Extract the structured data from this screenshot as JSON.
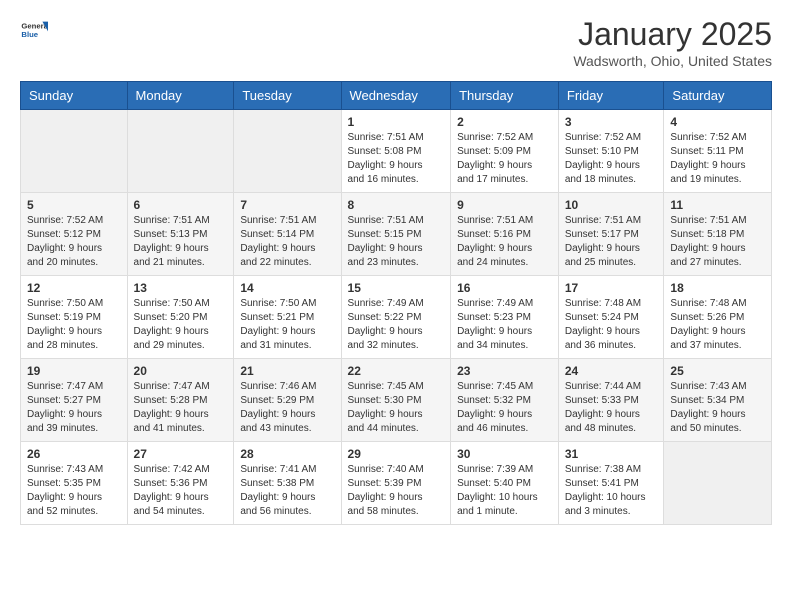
{
  "logo": {
    "general": "General",
    "blue": "Blue"
  },
  "header": {
    "title": "January 2025",
    "subtitle": "Wadsworth, Ohio, United States"
  },
  "weekdays": [
    "Sunday",
    "Monday",
    "Tuesday",
    "Wednesday",
    "Thursday",
    "Friday",
    "Saturday"
  ],
  "weeks": [
    [
      {
        "day": "",
        "info": ""
      },
      {
        "day": "",
        "info": ""
      },
      {
        "day": "",
        "info": ""
      },
      {
        "day": "1",
        "info": "Sunrise: 7:51 AM\nSunset: 5:08 PM\nDaylight: 9 hours\nand 16 minutes."
      },
      {
        "day": "2",
        "info": "Sunrise: 7:52 AM\nSunset: 5:09 PM\nDaylight: 9 hours\nand 17 minutes."
      },
      {
        "day": "3",
        "info": "Sunrise: 7:52 AM\nSunset: 5:10 PM\nDaylight: 9 hours\nand 18 minutes."
      },
      {
        "day": "4",
        "info": "Sunrise: 7:52 AM\nSunset: 5:11 PM\nDaylight: 9 hours\nand 19 minutes."
      }
    ],
    [
      {
        "day": "5",
        "info": "Sunrise: 7:52 AM\nSunset: 5:12 PM\nDaylight: 9 hours\nand 20 minutes."
      },
      {
        "day": "6",
        "info": "Sunrise: 7:51 AM\nSunset: 5:13 PM\nDaylight: 9 hours\nand 21 minutes."
      },
      {
        "day": "7",
        "info": "Sunrise: 7:51 AM\nSunset: 5:14 PM\nDaylight: 9 hours\nand 22 minutes."
      },
      {
        "day": "8",
        "info": "Sunrise: 7:51 AM\nSunset: 5:15 PM\nDaylight: 9 hours\nand 23 minutes."
      },
      {
        "day": "9",
        "info": "Sunrise: 7:51 AM\nSunset: 5:16 PM\nDaylight: 9 hours\nand 24 minutes."
      },
      {
        "day": "10",
        "info": "Sunrise: 7:51 AM\nSunset: 5:17 PM\nDaylight: 9 hours\nand 25 minutes."
      },
      {
        "day": "11",
        "info": "Sunrise: 7:51 AM\nSunset: 5:18 PM\nDaylight: 9 hours\nand 27 minutes."
      }
    ],
    [
      {
        "day": "12",
        "info": "Sunrise: 7:50 AM\nSunset: 5:19 PM\nDaylight: 9 hours\nand 28 minutes."
      },
      {
        "day": "13",
        "info": "Sunrise: 7:50 AM\nSunset: 5:20 PM\nDaylight: 9 hours\nand 29 minutes."
      },
      {
        "day": "14",
        "info": "Sunrise: 7:50 AM\nSunset: 5:21 PM\nDaylight: 9 hours\nand 31 minutes."
      },
      {
        "day": "15",
        "info": "Sunrise: 7:49 AM\nSunset: 5:22 PM\nDaylight: 9 hours\nand 32 minutes."
      },
      {
        "day": "16",
        "info": "Sunrise: 7:49 AM\nSunset: 5:23 PM\nDaylight: 9 hours\nand 34 minutes."
      },
      {
        "day": "17",
        "info": "Sunrise: 7:48 AM\nSunset: 5:24 PM\nDaylight: 9 hours\nand 36 minutes."
      },
      {
        "day": "18",
        "info": "Sunrise: 7:48 AM\nSunset: 5:26 PM\nDaylight: 9 hours\nand 37 minutes."
      }
    ],
    [
      {
        "day": "19",
        "info": "Sunrise: 7:47 AM\nSunset: 5:27 PM\nDaylight: 9 hours\nand 39 minutes."
      },
      {
        "day": "20",
        "info": "Sunrise: 7:47 AM\nSunset: 5:28 PM\nDaylight: 9 hours\nand 41 minutes."
      },
      {
        "day": "21",
        "info": "Sunrise: 7:46 AM\nSunset: 5:29 PM\nDaylight: 9 hours\nand 43 minutes."
      },
      {
        "day": "22",
        "info": "Sunrise: 7:45 AM\nSunset: 5:30 PM\nDaylight: 9 hours\nand 44 minutes."
      },
      {
        "day": "23",
        "info": "Sunrise: 7:45 AM\nSunset: 5:32 PM\nDaylight: 9 hours\nand 46 minutes."
      },
      {
        "day": "24",
        "info": "Sunrise: 7:44 AM\nSunset: 5:33 PM\nDaylight: 9 hours\nand 48 minutes."
      },
      {
        "day": "25",
        "info": "Sunrise: 7:43 AM\nSunset: 5:34 PM\nDaylight: 9 hours\nand 50 minutes."
      }
    ],
    [
      {
        "day": "26",
        "info": "Sunrise: 7:43 AM\nSunset: 5:35 PM\nDaylight: 9 hours\nand 52 minutes."
      },
      {
        "day": "27",
        "info": "Sunrise: 7:42 AM\nSunset: 5:36 PM\nDaylight: 9 hours\nand 54 minutes."
      },
      {
        "day": "28",
        "info": "Sunrise: 7:41 AM\nSunset: 5:38 PM\nDaylight: 9 hours\nand 56 minutes."
      },
      {
        "day": "29",
        "info": "Sunrise: 7:40 AM\nSunset: 5:39 PM\nDaylight: 9 hours\nand 58 minutes."
      },
      {
        "day": "30",
        "info": "Sunrise: 7:39 AM\nSunset: 5:40 PM\nDaylight: 10 hours\nand 1 minute."
      },
      {
        "day": "31",
        "info": "Sunrise: 7:38 AM\nSunset: 5:41 PM\nDaylight: 10 hours\nand 3 minutes."
      },
      {
        "day": "",
        "info": ""
      }
    ]
  ]
}
